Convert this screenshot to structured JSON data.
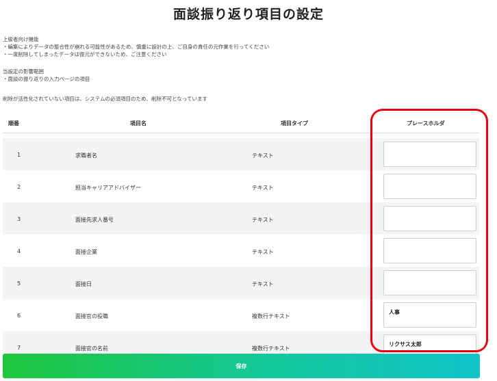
{
  "page": {
    "title": "面談振り返り項目の設定"
  },
  "notes": {
    "advanced_heading": "上級者向け機能",
    "advanced_line1": "・編集によりデータの整合性が崩れる可能性があるため、慎重に設計の上、ご自身の責任の元作業を行ってください",
    "advanced_line2": "・一度削除してしまったデータは復元ができないため、ご注意ください",
    "scope_heading": "当設定の影響範囲",
    "scope_line1": "・面談の振り返りの入力ページの項目",
    "delete_note": "削除が活性化されていない項目は、システムの必須項目のため、削除不可となっています"
  },
  "table": {
    "headers": {
      "order": "順番",
      "name": "項目名",
      "type": "項目タイプ",
      "placeholder": "プレースホルダ"
    },
    "rows": [
      {
        "order": "1",
        "name": "求職者名",
        "type": "テキスト",
        "placeholder": ""
      },
      {
        "order": "2",
        "name": "担当キャリアアドバイザー",
        "type": "テキスト",
        "placeholder": ""
      },
      {
        "order": "3",
        "name": "面接先求人番号",
        "type": "テキスト",
        "placeholder": ""
      },
      {
        "order": "4",
        "name": "面接企業",
        "type": "テキスト",
        "placeholder": ""
      },
      {
        "order": "5",
        "name": "面接日",
        "type": "テキスト",
        "placeholder": ""
      },
      {
        "order": "6",
        "name": "面接官の役職",
        "type": "複数行テキスト",
        "placeholder": "人事"
      },
      {
        "order": "7",
        "name": "面接官の名前",
        "type": "複数行テキスト",
        "placeholder": "リクサス太郎"
      }
    ]
  },
  "footer": {
    "save_label": "保存"
  },
  "colors": {
    "highlight": "#e60012",
    "save_gradient_start": "#1ec63c",
    "save_gradient_end": "#12c2c8"
  }
}
